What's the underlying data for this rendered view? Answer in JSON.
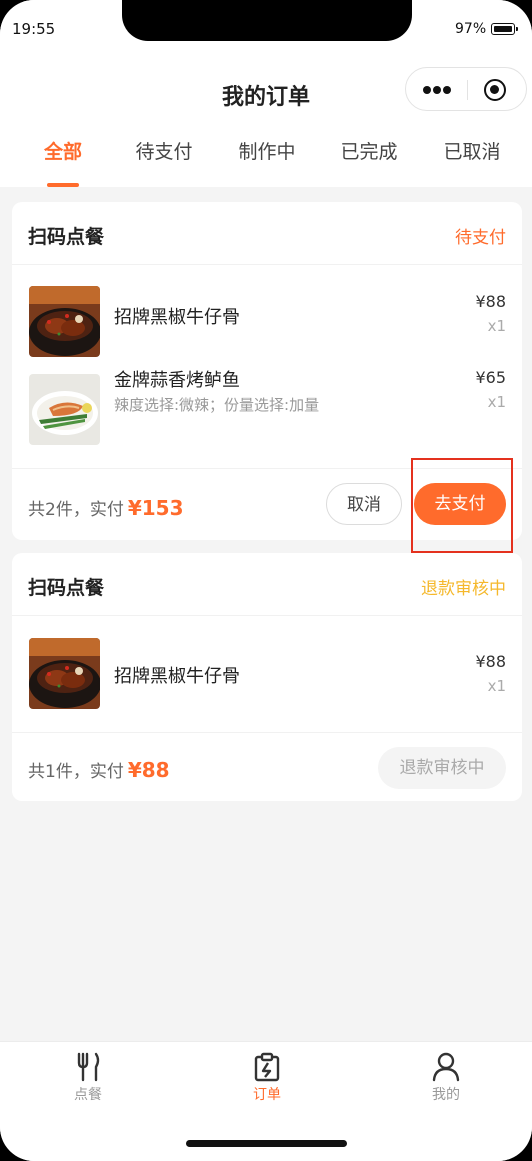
{
  "status_bar": {
    "time": "19:55",
    "battery": "97%"
  },
  "header": {
    "title": "我的订单"
  },
  "tabs": [
    {
      "label": "全部",
      "active": true
    },
    {
      "label": "待支付",
      "active": false
    },
    {
      "label": "制作中",
      "active": false
    },
    {
      "label": "已完成",
      "active": false
    },
    {
      "label": "已取消",
      "active": false
    }
  ],
  "orders": [
    {
      "title": "扫码点餐",
      "status": "待支付",
      "items": [
        {
          "name": "招牌黑椒牛仔骨",
          "spec": "",
          "price": "¥88",
          "qty": "x1"
        },
        {
          "name": "金牌蒜香烤鲈鱼",
          "spec": "辣度选择:微辣；份量选择:加量",
          "price": "¥65",
          "qty": "x1"
        }
      ],
      "summary": "共2件，实付",
      "total": "¥153",
      "buttons": {
        "cancel": "取消",
        "pay": "去支付"
      }
    },
    {
      "title": "扫码点餐",
      "status": "退款审核中",
      "items": [
        {
          "name": "招牌黑椒牛仔骨",
          "spec": "",
          "price": "¥88",
          "qty": "x1"
        }
      ],
      "summary": "共1件，实付",
      "total": "¥88",
      "buttons": {
        "refund": "退款审核中"
      }
    }
  ],
  "tabbar": [
    {
      "label": "点餐",
      "icon": "fork-knife-icon",
      "active": false
    },
    {
      "label": "订单",
      "icon": "clipboard-icon",
      "active": true
    },
    {
      "label": "我的",
      "icon": "user-icon",
      "active": false
    }
  ],
  "colors": {
    "accent": "#ff6b2c",
    "refund_status": "#f5b82b",
    "highlight_box": "#e4311e"
  }
}
